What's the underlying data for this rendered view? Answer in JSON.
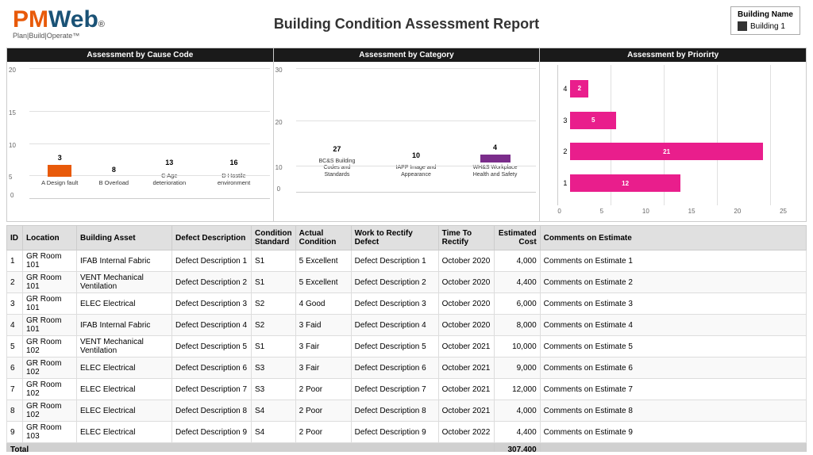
{
  "header": {
    "title": "Building Condition Assessment Report",
    "logo": {
      "plan_build": "Plan|Build|Operate™",
      "registered": "®"
    },
    "legend": {
      "title": "Building Name",
      "items": [
        {
          "label": "Building 1",
          "color": "#333"
        }
      ]
    }
  },
  "charts": {
    "cause_code": {
      "title": "Assessment by Cause Code",
      "y_max": 20,
      "y_ticks": [
        0,
        5,
        10,
        15,
        20
      ],
      "bars": [
        {
          "label": "A Design fault",
          "value": 3,
          "height_pct": 15
        },
        {
          "label": "B Overload",
          "value": 8,
          "height_pct": 40
        },
        {
          "label": "C Age deterioration",
          "value": 13,
          "height_pct": 65
        },
        {
          "label": "D Hostile environment",
          "value": 16,
          "height_pct": 80
        }
      ]
    },
    "category": {
      "title": "Assessment by Category",
      "y_max": 30,
      "y_ticks": [
        0,
        10,
        20,
        30
      ],
      "bars": [
        {
          "label": "BC&S Building Codes and Standards",
          "value": 27,
          "height_pct": 90
        },
        {
          "label": "IAPP Image and Appearance",
          "value": 10,
          "height_pct": 33
        },
        {
          "label": "WH&S Workplace Health and Safety",
          "value": 4,
          "height_pct": 13
        }
      ]
    },
    "priority": {
      "title": "Assessment by Priorirty",
      "x_max": 25,
      "x_ticks": [
        0,
        5,
        10,
        15,
        20,
        25
      ],
      "bars": [
        {
          "label": "4",
          "value": 2,
          "width_pct": 8
        },
        {
          "label": "3",
          "value": 5,
          "width_pct": 20
        },
        {
          "label": "2",
          "value": 21,
          "width_pct": 84
        },
        {
          "label": "1",
          "value": 12,
          "width_pct": 48
        }
      ]
    }
  },
  "table": {
    "columns": [
      "ID",
      "Location",
      "Building Asset",
      "Defect Description",
      "Condition Standard",
      "Actual Condition",
      "Work to Rectify Defect",
      "Time To Rectify",
      "Estimated Cost",
      "Comments on Estimate"
    ],
    "rows": [
      {
        "id": 1,
        "location": "GR Room 101",
        "asset": "IFAB Internal Fabric",
        "defect": "Defect Description 1",
        "cond_std": "S1",
        "actual": "5 Excellent",
        "work": "Defect Description 1",
        "time": "October 2020",
        "cost": "4,000",
        "comments": "Comments on Estimate 1"
      },
      {
        "id": 2,
        "location": "GR Room 101",
        "asset": "VENT Mechanical Ventilation",
        "defect": "Defect Description 2",
        "cond_std": "S1",
        "actual": "5 Excellent",
        "work": "Defect Description 2",
        "time": "October 2020",
        "cost": "4,400",
        "comments": "Comments on Estimate 2"
      },
      {
        "id": 3,
        "location": "GR Room 101",
        "asset": "ELEC Electrical",
        "defect": "Defect Description 3",
        "cond_std": "S2",
        "actual": "4 Good",
        "work": "Defect Description 3",
        "time": "October 2020",
        "cost": "6,000",
        "comments": "Comments on Estimate 3"
      },
      {
        "id": 4,
        "location": "GR Room 101",
        "asset": "IFAB Internal Fabric",
        "defect": "Defect Description 4",
        "cond_std": "S2",
        "actual": "3 Faid",
        "work": "Defect Description 4",
        "time": "October 2020",
        "cost": "8,000",
        "comments": "Comments on Estimate 4"
      },
      {
        "id": 5,
        "location": "GR Room 102",
        "asset": "VENT Mechanical Ventilation",
        "defect": "Defect Description 5",
        "cond_std": "S1",
        "actual": "3 Fair",
        "work": "Defect Description 5",
        "time": "October 2021",
        "cost": "10,000",
        "comments": "Comments on Estimate 5"
      },
      {
        "id": 6,
        "location": "GR Room 102",
        "asset": "ELEC Electrical",
        "defect": "Defect Description 6",
        "cond_std": "S3",
        "actual": "3 Fair",
        "work": "Defect Description 6",
        "time": "October 2021",
        "cost": "9,000",
        "comments": "Comments on Estimate 6"
      },
      {
        "id": 7,
        "location": "GR Room 102",
        "asset": "ELEC Electrical",
        "defect": "Defect Description 7",
        "cond_std": "S3",
        "actual": "2 Poor",
        "work": "Defect Description 7",
        "time": "October 2021",
        "cost": "12,000",
        "comments": "Comments on Estimate 7"
      },
      {
        "id": 8,
        "location": "GR Room 102",
        "asset": "ELEC Electrical",
        "defect": "Defect Description 8",
        "cond_std": "S4",
        "actual": "2 Poor",
        "work": "Defect Description 8",
        "time": "October 2021",
        "cost": "4,000",
        "comments": "Comments on Estimate 8"
      },
      {
        "id": 9,
        "location": "GR Room 103",
        "asset": "ELEC Electrical",
        "defect": "Defect Description 9",
        "cond_std": "S4",
        "actual": "2 Poor",
        "work": "Defect Description 9",
        "time": "October 2022",
        "cost": "4,400",
        "comments": "Comments on Estimate 9"
      }
    ],
    "footer": {
      "label": "Total",
      "total_cost": "307,400"
    }
  }
}
